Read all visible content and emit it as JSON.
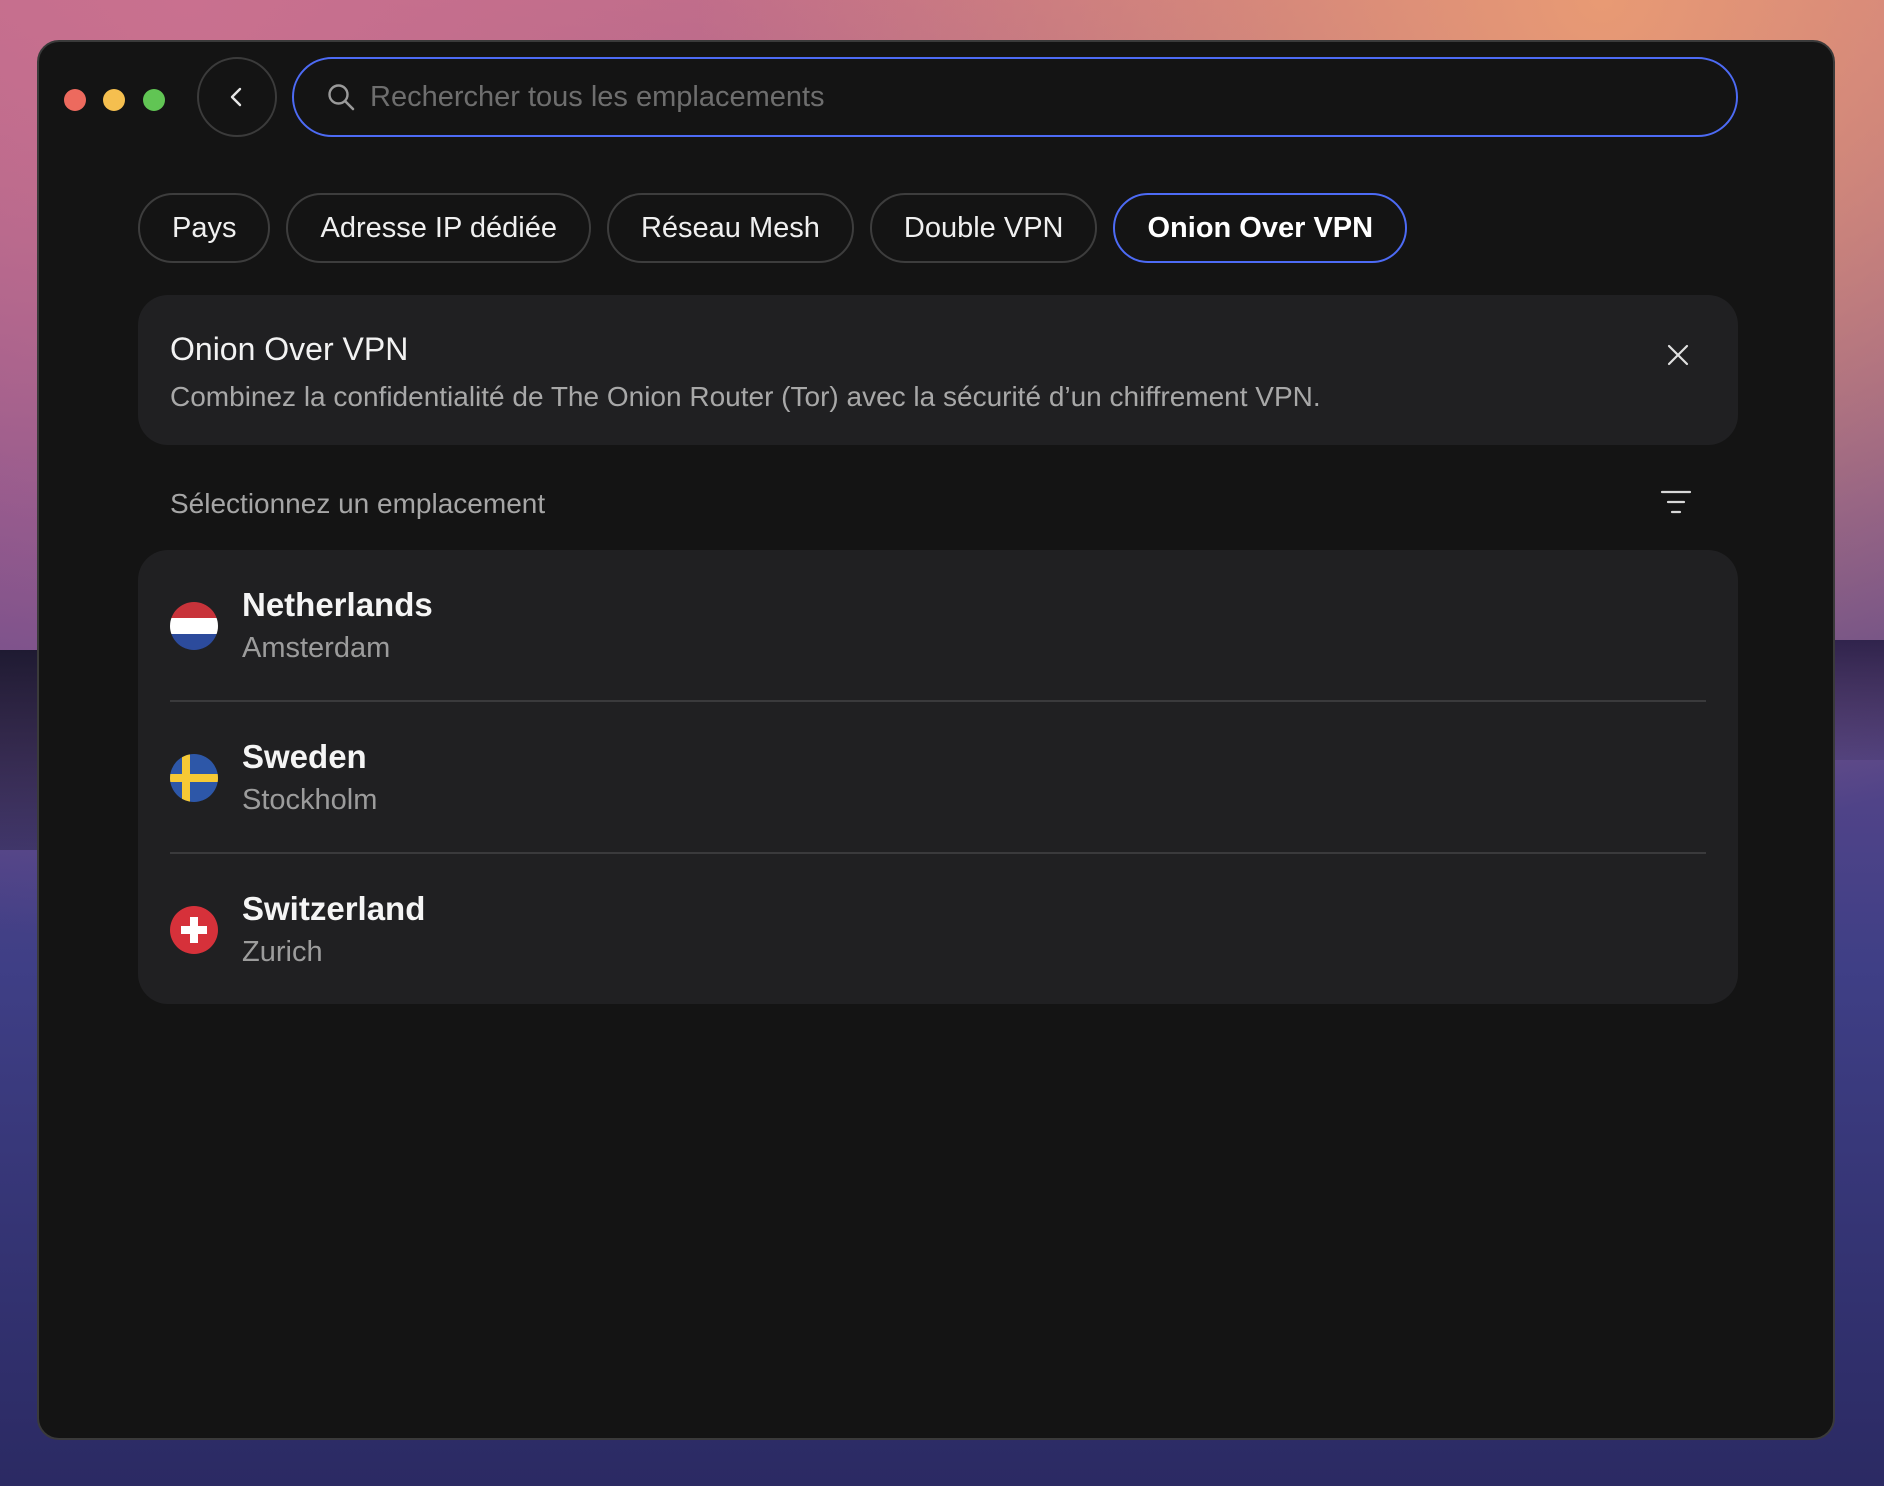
{
  "search": {
    "placeholder": "Rechercher tous les emplacements",
    "value": ""
  },
  "tabs": [
    {
      "label": "Pays",
      "active": false
    },
    {
      "label": "Adresse IP dédiée",
      "active": false
    },
    {
      "label": "Réseau Mesh",
      "active": false
    },
    {
      "label": "Double VPN",
      "active": false
    },
    {
      "label": "Onion Over VPN",
      "active": true
    }
  ],
  "info": {
    "title": "Onion Over VPN",
    "description": "Combinez la confidentialité de The Onion Router (Tor) avec la sécurité d’un chiffrement VPN."
  },
  "section_label": "Sélectionnez un emplacement",
  "locations": [
    {
      "country": "Netherlands",
      "city": "Amsterdam",
      "flag": "netherlands-flag-icon"
    },
    {
      "country": "Sweden",
      "city": "Stockholm",
      "flag": "sweden-flag-icon"
    },
    {
      "country": "Switzerland",
      "city": "Zurich",
      "flag": "switzerland-flag-icon"
    }
  ],
  "colors": {
    "accent": "#4d6bf5",
    "window_bg": "#141414",
    "card_bg": "#202022"
  },
  "icons": {
    "back": "chevron-left-icon",
    "search": "search-icon",
    "close": "close-icon",
    "filter": "filter-icon"
  }
}
